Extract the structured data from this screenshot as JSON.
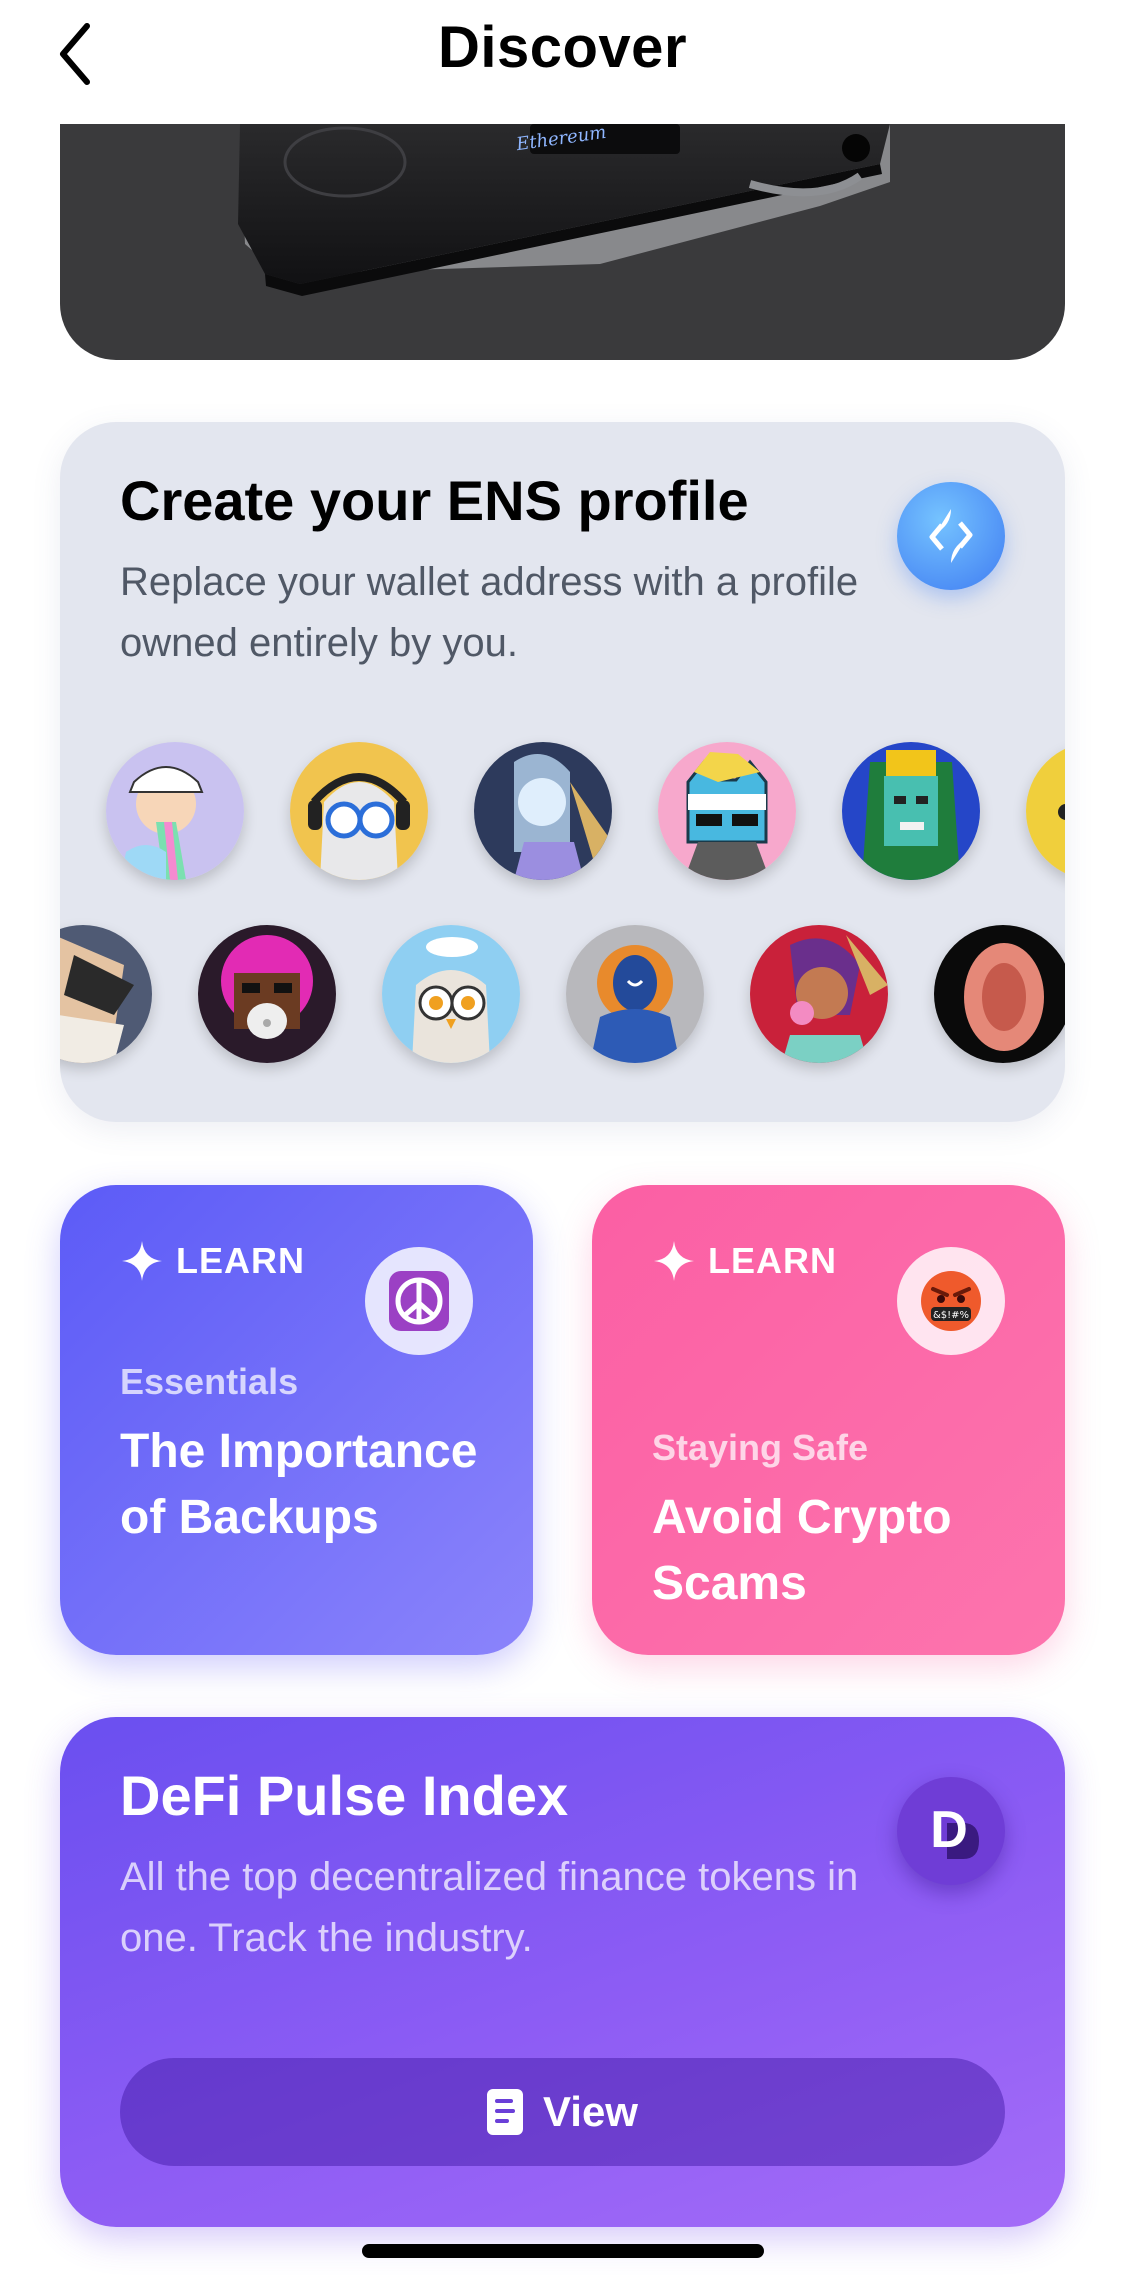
{
  "nav": {
    "title": "Discover"
  },
  "ledger_card": {
    "device_text": "Ethereum"
  },
  "ens": {
    "title": "Create your ENS profile",
    "subtitle": "Replace your wallet address with a profile owned entirely by you."
  },
  "learn_cards": [
    {
      "tag": "LEARN",
      "category": "Essentials",
      "title": "The Importance of Backups",
      "emoji": "☮️"
    },
    {
      "tag": "LEARN",
      "category": "Staying Safe",
      "title": "Avoid Crypto Scams",
      "emoji": "🤬"
    }
  ],
  "defi": {
    "title": "DeFi Pulse Index",
    "subtitle": "All the top decentralized finance tokens in one. Track the industry.",
    "button_label": "View",
    "logo_letter": "D"
  },
  "colors": {
    "ens_card_bg": "#e3e6ef",
    "learn_purple": "#5c5bf7",
    "learn_pink": "#fb5fa4",
    "defi_purple": "#8d5cf4",
    "ens_blue": "#4d8ef5"
  }
}
